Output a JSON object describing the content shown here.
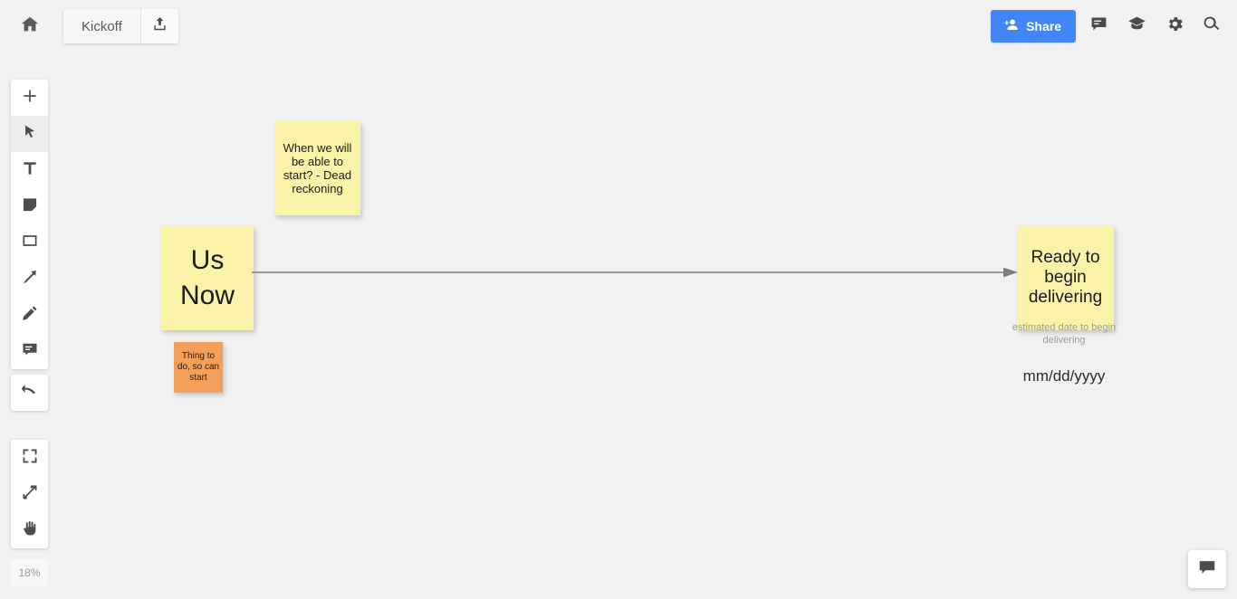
{
  "app": {
    "background_color": "#f1f1f1",
    "zoom_level": "18%"
  },
  "topbar": {
    "home_icon": "home-icon",
    "board_name": "Kickoff",
    "export_icon": "upload-export-icon",
    "share_label": "Share",
    "share_icon": "person-add-icon",
    "share_color": "#4285f4",
    "icons": [
      {
        "name": "comments-icon",
        "label": "Comments"
      },
      {
        "name": "academy-icon",
        "label": "Miro Academy"
      },
      {
        "name": "settings-icon",
        "label": "Settings"
      },
      {
        "name": "search-icon",
        "label": "Search"
      }
    ]
  },
  "toolbar": {
    "main_tools": [
      {
        "name": "add-apps-tool",
        "icon": "plus-icon",
        "active": false
      },
      {
        "name": "select-tool",
        "icon": "cursor-icon",
        "active": true
      },
      {
        "name": "text-tool",
        "icon": "text-t-icon",
        "active": false
      },
      {
        "name": "sticky-note-tool",
        "icon": "sticky-note-icon",
        "active": false
      },
      {
        "name": "shape-tool",
        "icon": "rectangle-icon",
        "active": false
      },
      {
        "name": "connector-tool",
        "icon": "arrow-icon",
        "active": false
      },
      {
        "name": "pen-tool",
        "icon": "pencil-icon",
        "active": false
      },
      {
        "name": "comment-tool",
        "icon": "comment-icon",
        "active": false
      }
    ],
    "undo_tool": {
      "name": "undo-tool",
      "icon": "undo-arrow-icon"
    },
    "view_tools": [
      {
        "name": "fit-to-screen-tool",
        "icon": "frame-fit-icon"
      },
      {
        "name": "zoom-expand-tool",
        "icon": "diagonal-arrows-icon"
      },
      {
        "name": "pan-hand-tool",
        "icon": "hand-icon"
      }
    ]
  },
  "canvas": {
    "notes": [
      {
        "id": "note-question",
        "text": "When we will be able to start? - Dead reckoning",
        "color": "#faf2a8"
      },
      {
        "id": "note-usnow",
        "text": "Us Now",
        "color": "#faf2a8"
      },
      {
        "id": "note-thing",
        "text": "Thing to do, so can start",
        "color": "#f5a05a"
      },
      {
        "id": "note-ready",
        "text": "Ready to begin delivering",
        "color": "#faf2a8"
      }
    ],
    "caption": "estimated date to begin delivering",
    "date_placeholder": "mm/dd/yyyy",
    "connector": {
      "name": "timeline-arrow",
      "color": "#7d7d7d"
    }
  },
  "chat": {
    "icon": "chat-bubble-icon"
  }
}
